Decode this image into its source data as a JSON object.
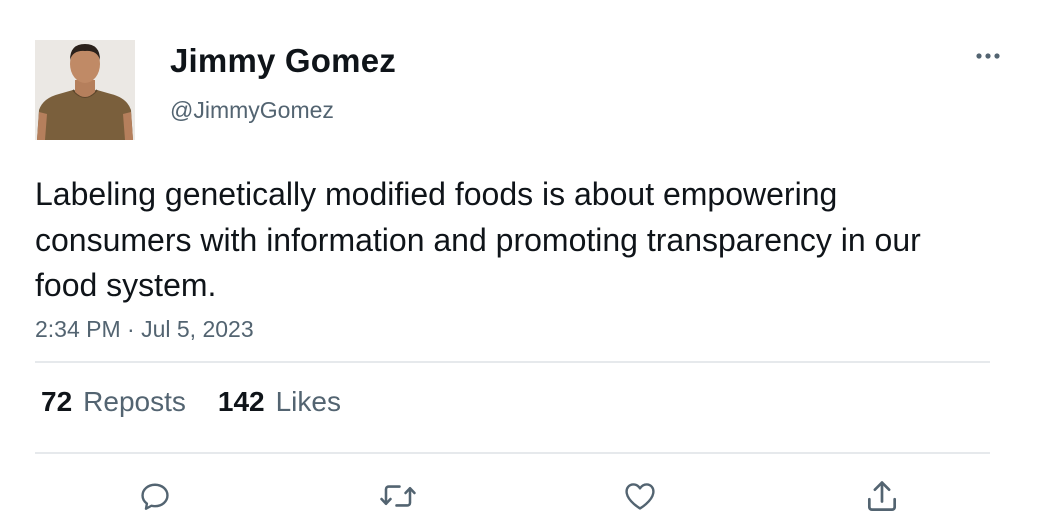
{
  "author": {
    "name": "Jimmy Gomez",
    "handle": "@JimmyGomez"
  },
  "tweet": {
    "text": "Labeling genetically modified foods is about empowering consumers with information and promoting transparency in our food system.",
    "timestamp": "2:34 PM · Jul 5, 2023"
  },
  "stats": {
    "reposts_count": "72",
    "reposts_label": "Reposts",
    "likes_count": "142",
    "likes_label": "Likes"
  },
  "icons": {
    "more": "more-horizontal-icon",
    "reply": "reply-icon",
    "repost": "repost-icon",
    "like": "heart-icon",
    "share": "share-icon"
  },
  "colors": {
    "primary_text": "#0f1419",
    "secondary_text": "#536471",
    "divider": "#e6e9ec"
  }
}
